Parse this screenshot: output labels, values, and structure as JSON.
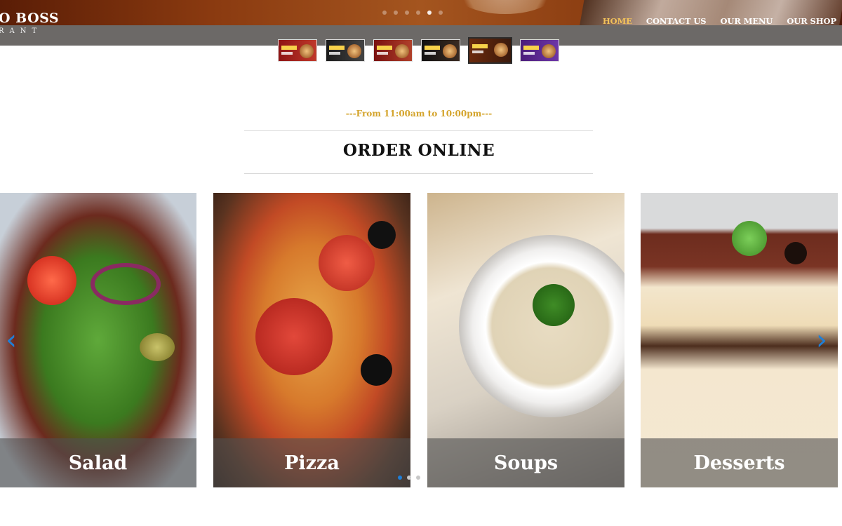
{
  "brand": {
    "name": "O BOSS",
    "subtitle": "RANT"
  },
  "nav": {
    "items": [
      {
        "label": "HOME",
        "active": true
      },
      {
        "label": "CONTACT US",
        "active": false
      },
      {
        "label": "OUR MENU",
        "active": false
      },
      {
        "label": "OUR SHOP",
        "active": false
      }
    ]
  },
  "hero_slider": {
    "slide_count": 6,
    "active_index": 4
  },
  "thumbnails": {
    "count": 6,
    "active_index": 4
  },
  "section": {
    "hours": "---From 11:00am to 10:00pm---",
    "title": "ORDER ONLINE"
  },
  "categories": [
    {
      "label": "Salad"
    },
    {
      "label": "Pizza"
    },
    {
      "label": "Soups"
    },
    {
      "label": "Desserts"
    }
  ],
  "carousel": {
    "dots": 3,
    "active_index": 0
  },
  "colors": {
    "accent": "#d4a42c",
    "nav_active": "#f2c25a",
    "arrow": "#1f7fd8"
  },
  "icons": {
    "prev": "chevron-left-icon",
    "next": "chevron-right-icon"
  }
}
